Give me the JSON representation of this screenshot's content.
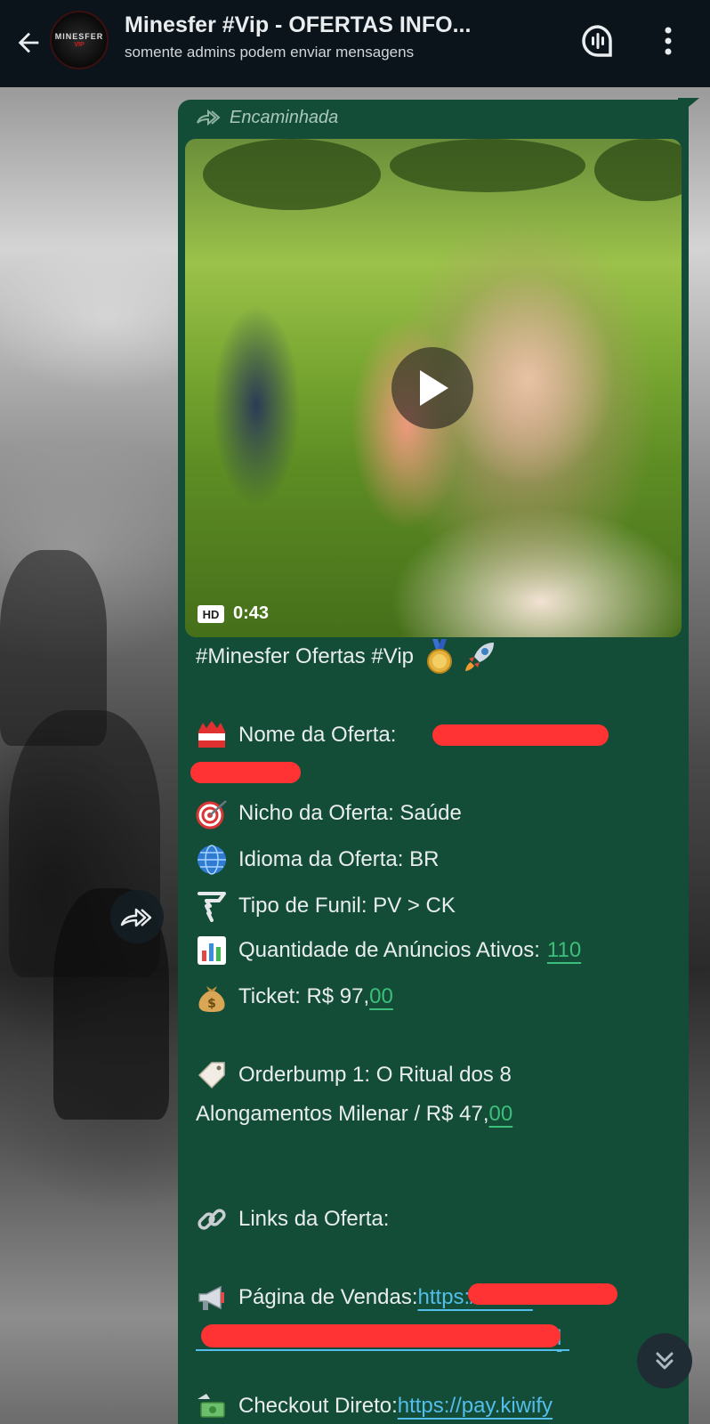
{
  "header": {
    "title": "Minesfer #Vip - OFERTAS INFO...",
    "subtitle": "somente admins podem enviar mensagens",
    "avatar_line1": "MINESFER",
    "avatar_line2": "VIP"
  },
  "message": {
    "forwarded_label": "Encaminhada",
    "video": {
      "hd_label": "HD",
      "duration": "0:43"
    },
    "hashtag_line": "#Minesfer Ofertas #Vip",
    "offer_name_label": "Nome da Oferta:",
    "niche": "Nicho da Oferta: Saúde",
    "language": "Idioma da Oferta: BR",
    "funnel": "Tipo de Funil: PV > CK",
    "ads_label": "Quantidade de Anúncios Ativos: ",
    "ads_value": "110",
    "ticket_label": "Ticket: R$ 97,",
    "ticket_cents": "00",
    "orderbump_line1": "Orderbump 1: O Ritual dos 8",
    "orderbump_line2_label": "Alongamentos Milenar / R$ 47,",
    "orderbump_cents": "00",
    "links_label": "Links da Oferta:",
    "sales_page_label": "Página de Vendas: ",
    "sales_page_url_visible": "https://www.",
    "sales_page_url_tail": "l",
    "checkout_label": "Checkout Direto: ",
    "checkout_url": "https://pay.kiwify"
  },
  "icons": {
    "back": "arrow-left-icon",
    "voice": "voice-chat-icon",
    "menu": "more-vertical-icon",
    "forward": "forward-icon",
    "play": "play-icon",
    "scroll": "chevron-double-down-icon"
  },
  "colors": {
    "bubble": "#144d37",
    "appbar": "#0b141a",
    "link_green": "#3bbf7a",
    "url_blue": "#53bdeb",
    "redaction": "#ff3333"
  }
}
